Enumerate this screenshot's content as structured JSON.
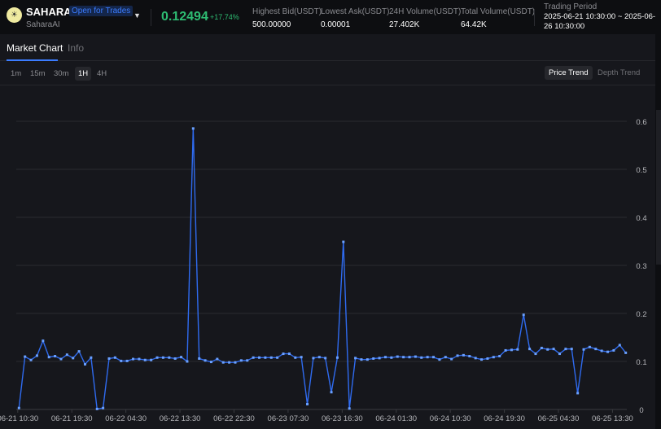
{
  "header": {
    "symbol": "SAHARA",
    "status_badge": "Open for Trades",
    "project_name": "SaharaAI",
    "price": "0.12494",
    "change": "+17.74%",
    "stats": [
      {
        "label": "Highest Bid(USDT)",
        "value": "500.00000"
      },
      {
        "label": "Lowest Ask(USDT)",
        "value": "0.00001"
      },
      {
        "label": "24H Volume(USDT)",
        "value": "27.402K"
      },
      {
        "label": "Total Volume(USDT)",
        "value": "64.42K"
      }
    ],
    "trading_period": {
      "label": "Trading Period",
      "value": "2025-06-21 10:30:00 ~ 2025-06-26 10:30:00"
    }
  },
  "tabs": [
    {
      "label": "Market Chart"
    },
    {
      "label": "Info"
    }
  ],
  "intervals": [
    "1m",
    "15m",
    "30m",
    "1H",
    "4H"
  ],
  "active_interval": "1H",
  "trend_tabs": [
    "Price Trend",
    "Depth Trend"
  ],
  "colors": {
    "accent": "#3b7cff",
    "positive": "#2ebd73",
    "line": "#2f6bf0"
  },
  "chart_data": {
    "type": "line",
    "title": "",
    "xlabel": "",
    "ylabel": "",
    "interval": "1H",
    "start": "06-21 10:30",
    "ylim": [
      0,
      0.6
    ],
    "yticks": [
      "0",
      "0.1",
      "0.2",
      "0.3",
      "0.4",
      "0.5",
      "0.6"
    ],
    "xticks": [
      "06-21 10:30",
      "06-21 19:30",
      "06-22 04:30",
      "06-22 13:30",
      "06-22 22:30",
      "06-23 07:30",
      "06-23 16:30",
      "06-24 01:30",
      "06-24 10:30",
      "06-24 19:30",
      "06-25 04:30",
      "06-25 13:30"
    ],
    "xtick_step_hours": 9,
    "series": [
      {
        "name": "Price",
        "values": [
          0.003,
          0.11,
          0.103,
          0.112,
          0.143,
          0.109,
          0.111,
          0.105,
          0.114,
          0.107,
          0.121,
          0.094,
          0.108,
          0.001,
          0.003,
          0.106,
          0.108,
          0.101,
          0.101,
          0.105,
          0.105,
          0.103,
          0.103,
          0.108,
          0.108,
          0.108,
          0.106,
          0.109,
          0.1,
          0.585,
          0.106,
          0.102,
          0.099,
          0.105,
          0.098,
          0.098,
          0.098,
          0.102,
          0.102,
          0.108,
          0.108,
          0.108,
          0.108,
          0.108,
          0.116,
          0.116,
          0.108,
          0.109,
          0.011,
          0.107,
          0.109,
          0.107,
          0.036,
          0.108,
          0.349,
          0.002,
          0.107,
          0.104,
          0.104,
          0.106,
          0.107,
          0.109,
          0.108,
          0.11,
          0.109,
          0.109,
          0.11,
          0.108,
          0.109,
          0.109,
          0.104,
          0.109,
          0.105,
          0.112,
          0.113,
          0.111,
          0.107,
          0.104,
          0.106,
          0.109,
          0.111,
          0.123,
          0.124,
          0.125,
          0.197,
          0.126,
          0.116,
          0.128,
          0.125,
          0.126,
          0.116,
          0.126,
          0.126,
          0.034,
          0.125,
          0.13,
          0.126,
          0.122,
          0.12,
          0.123,
          0.134,
          0.118
        ]
      }
    ]
  }
}
